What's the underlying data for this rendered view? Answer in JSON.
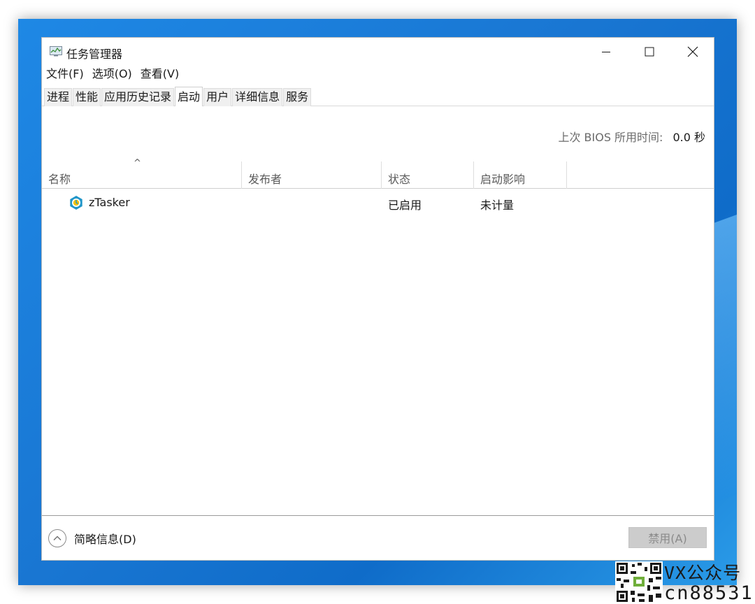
{
  "window": {
    "title": "任务管理器",
    "controls": {
      "minimize": "—",
      "maximize": "☐",
      "close": "✕"
    }
  },
  "menu": [
    "文件(F)",
    "选项(O)",
    "查看(V)"
  ],
  "tabs": [
    {
      "label": "进程",
      "active": false
    },
    {
      "label": "性能",
      "active": false
    },
    {
      "label": "应用历史记录",
      "active": false
    },
    {
      "label": "启动",
      "active": true
    },
    {
      "label": "用户",
      "active": false
    },
    {
      "label": "详细信息",
      "active": false
    },
    {
      "label": "服务",
      "active": false
    }
  ],
  "bios": {
    "label": "上次 BIOS 所用时间:",
    "value": "0.0 秒"
  },
  "table": {
    "sort_indicator": "^",
    "columns": [
      "名称",
      "发布者",
      "状态",
      "启动影响"
    ],
    "rows": [
      {
        "icon": "ztasker-icon",
        "name": "zTasker",
        "publisher": "",
        "status": "已启用",
        "impact": "未计量"
      }
    ]
  },
  "footer": {
    "fewer_details": "简略信息(D)",
    "disable_button": "禁用(A)"
  },
  "watermark": {
    "line1": "VX公众号",
    "line2": "cn88531"
  },
  "colors": {
    "desktop": "#1976d2",
    "window_bg": "#ffffff",
    "disabled_button_bg": "#cccccc",
    "disabled_button_text": "#8a8a8a",
    "ztasker_icon": "#2196c9"
  }
}
